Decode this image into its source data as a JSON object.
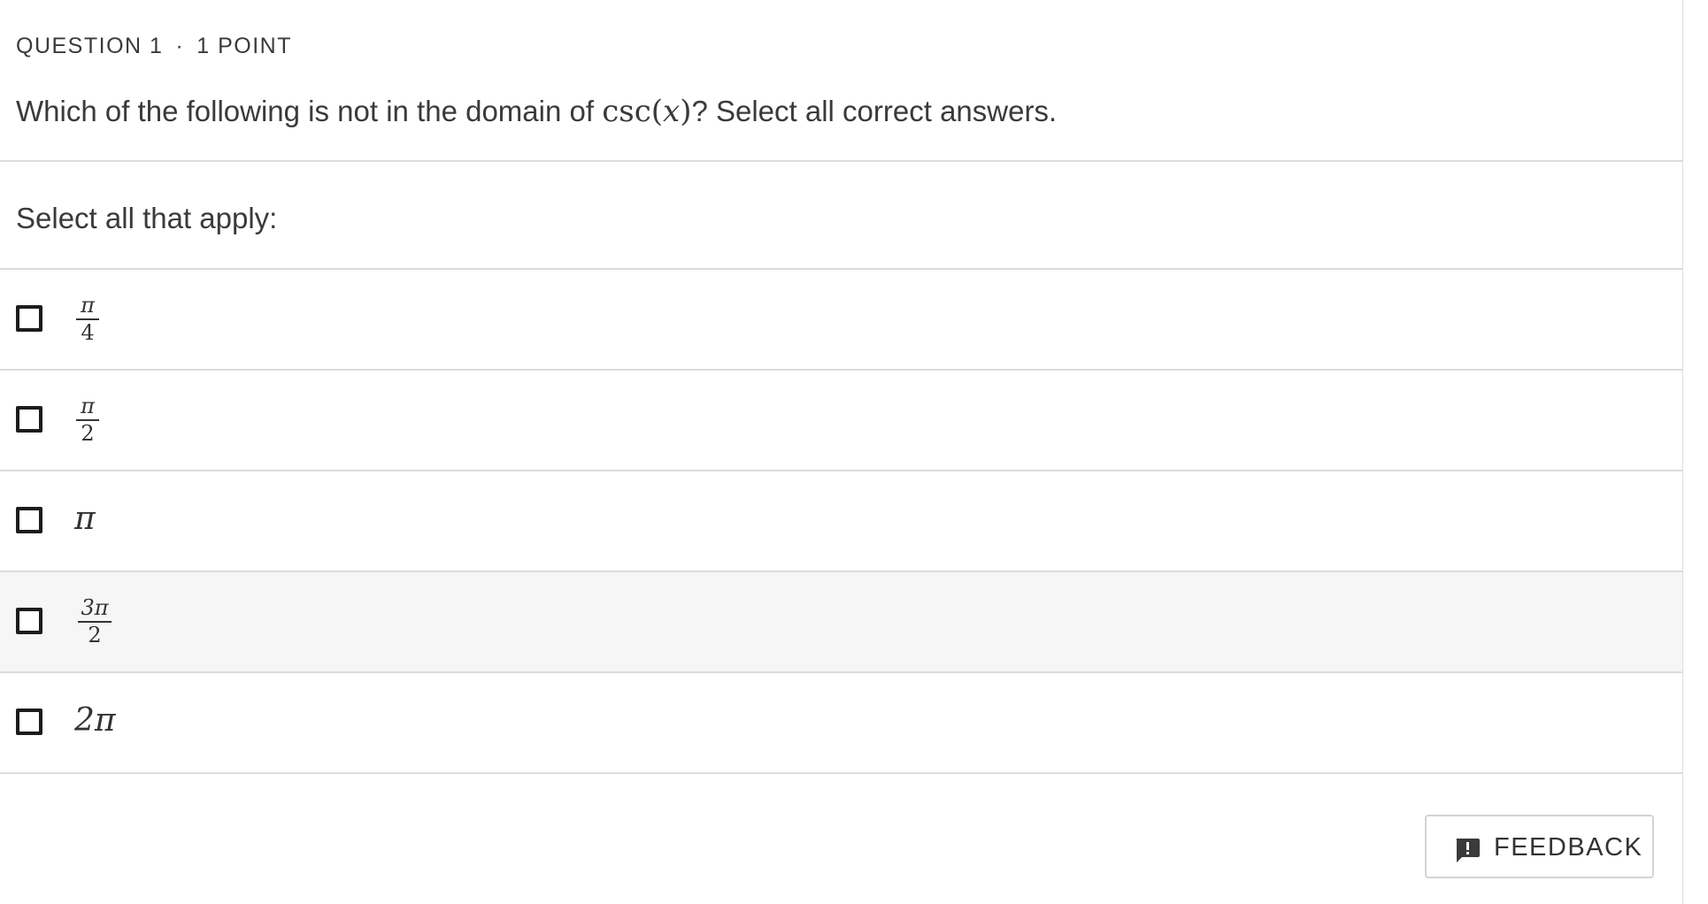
{
  "question": {
    "number_label": "QUESTION 1",
    "separator": "·",
    "points_label": "1 POINT",
    "prompt_before": "Which of the following is not in the domain of ",
    "prompt_math": "csc(x)",
    "prompt_after": "? Select all correct answers."
  },
  "instruction": "Select all that apply:",
  "options": [
    {
      "kind": "fraction",
      "numerator": "π",
      "denominator": "4",
      "checked": false
    },
    {
      "kind": "fraction",
      "numerator": "π",
      "denominator": "2",
      "checked": false
    },
    {
      "kind": "inline",
      "text": "π",
      "checked": false
    },
    {
      "kind": "fraction",
      "numerator": "3π",
      "denominator": "2",
      "checked": false,
      "hovered": true
    },
    {
      "kind": "inline",
      "text": "2π",
      "checked": false
    }
  ],
  "feedback_button": {
    "label": "FEEDBACK",
    "icon": "feedback-speech-bubble-icon"
  },
  "colors": {
    "text": "#333333",
    "divider": "#dcdcdc",
    "hover_row": "#f6f6f6",
    "checkbox_border": "#1c1c1c"
  }
}
